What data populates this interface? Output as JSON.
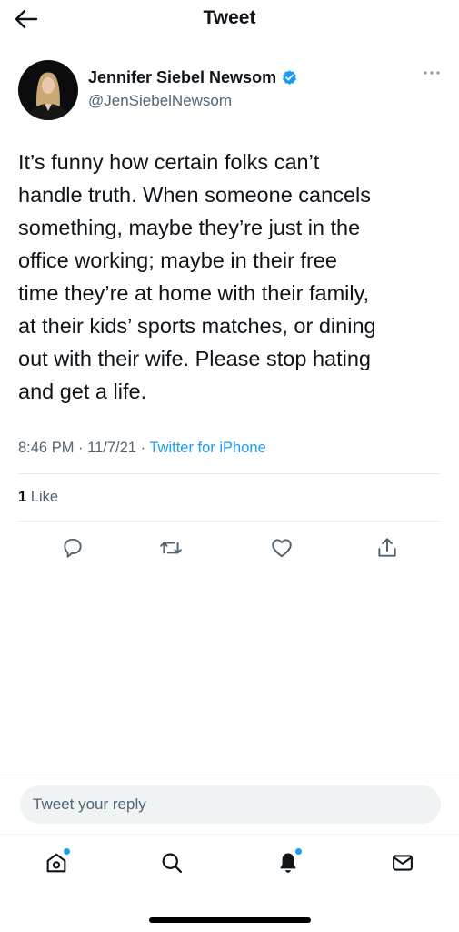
{
  "header": {
    "title": "Tweet",
    "back_icon": "arrow-left-icon"
  },
  "author": {
    "name": "Jennifer Siebel Newsom",
    "handle": "@JenSiebelNewsom",
    "verified": true,
    "verified_color": "#1d9bf0"
  },
  "tweet": {
    "text": "It’s funny how certain folks can’t\nhandle truth. When someone cancels\nsomething, maybe they’re just in the\noffice working; maybe in their free\ntime they’re at home with their family,\nat their kids’ sports matches, or dining\nout with their wife. Please stop hating\nand get a life.",
    "time": "8:46 PM",
    "date": "11/7/21",
    "separator": "·",
    "source": "Twitter for iPhone"
  },
  "stats": {
    "likes_count": "1",
    "likes_label": "Like"
  },
  "actions": [
    "reply-icon",
    "retweet-icon",
    "like-icon",
    "share-icon"
  ],
  "reply": {
    "placeholder": "Tweet your reply"
  },
  "tabbar": {
    "items": [
      "home-icon",
      "search-icon",
      "notifications-icon",
      "messages-icon"
    ]
  },
  "colors": {
    "accent": "#1d9bf0",
    "text_primary": "#0f1419",
    "text_secondary": "#536471"
  }
}
